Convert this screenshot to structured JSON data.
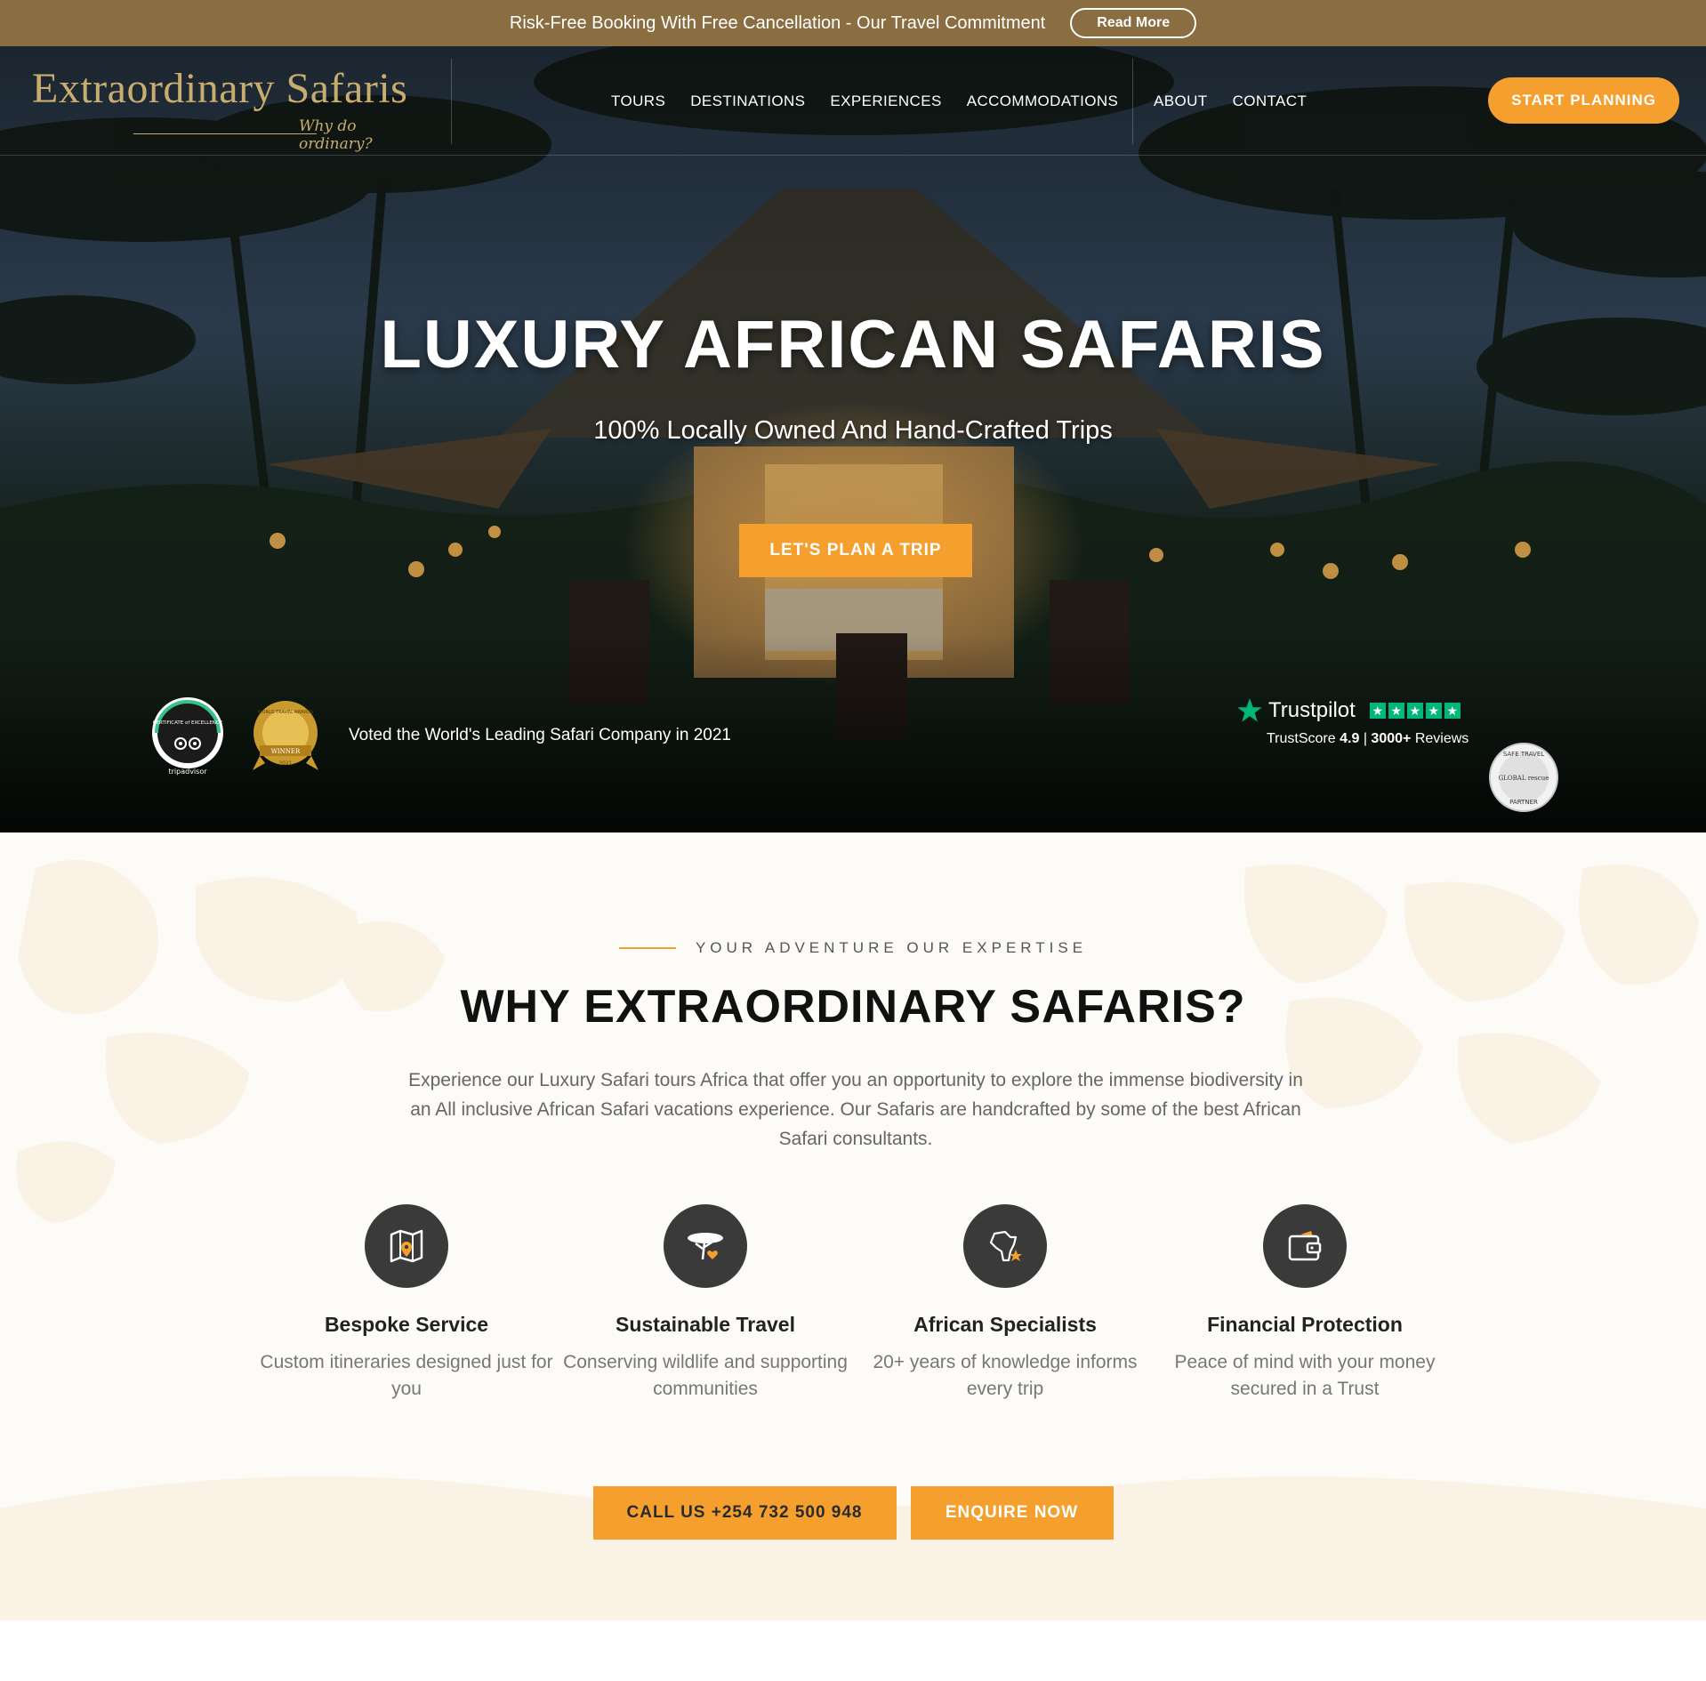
{
  "topbar": {
    "text": "Risk-Free Booking With Free Cancellation - Our Travel Commitment",
    "read_more": "Read More"
  },
  "brand": {
    "name": "Extraordinary Safaris",
    "tagline": "Why do ordinary?"
  },
  "nav": {
    "primary": [
      "TOURS",
      "DESTINATIONS",
      "EXPERIENCES",
      "ACCOMMODATIONS"
    ],
    "secondary": [
      "ABOUT",
      "CONTACT"
    ],
    "cta": "START PLANNING"
  },
  "hero": {
    "title": "LUXURY AFRICAN SAFARIS",
    "subtitle": "100% Locally Owned And Hand-Crafted Trips",
    "button": "LET'S PLAN A TRIP",
    "award_text": "Voted the World's Leading Safari Company in 2021",
    "badges": {
      "tripadvisor_top": "CERTIFICATE of EXCELLENCE",
      "tripadvisor_bottom": "tripadvisor",
      "wta_top": "WORLD TRAVEL AWARDS",
      "wta_ribbon": "WINNER",
      "wta_year": "2021",
      "partner_top": "SAFE TRAVEL",
      "partner_mid": "GLOBAL rescue",
      "partner_bottom": "PARTNER"
    },
    "trustpilot": {
      "name": "Trustpilot",
      "score_label": "TrustScore",
      "score": "4.9",
      "separator": "|",
      "reviews_count": "3000+",
      "reviews_label": "Reviews",
      "stars": 5
    }
  },
  "why": {
    "eyebrow": "YOUR ADVENTURE OUR EXPERTISE",
    "title": "WHY EXTRAORDINARY SAFARIS?",
    "description": "Experience our Luxury Safari tours Africa that offer you an opportunity to explore the immense biodiversity in an All inclusive African Safari vacations experience. Our Safaris are handcrafted by some of the best African Safari consultants.",
    "features": [
      {
        "icon": "map-pin-icon",
        "title": "Bespoke Service",
        "text": "Custom itineraries designed just for you"
      },
      {
        "icon": "acacia-tree-icon",
        "title": "Sustainable Travel",
        "text": "Conserving wildlife and supporting communities"
      },
      {
        "icon": "africa-map-icon",
        "title": "African Specialists",
        "text": "20+ years of knowledge informs every trip"
      },
      {
        "icon": "wallet-icon",
        "title": "Financial Protection",
        "text": "Peace of mind with your money secured in a Trust"
      }
    ],
    "call_button": "CALL US +254 732 500 948",
    "enquire_button": "ENQUIRE NOW"
  },
  "colors": {
    "accent": "#f5a02e",
    "topbar": "#8a6d40",
    "brand_gold": "#c9ad6e",
    "trust_green": "#00b67a",
    "icon_dark": "#3a3a3a"
  }
}
